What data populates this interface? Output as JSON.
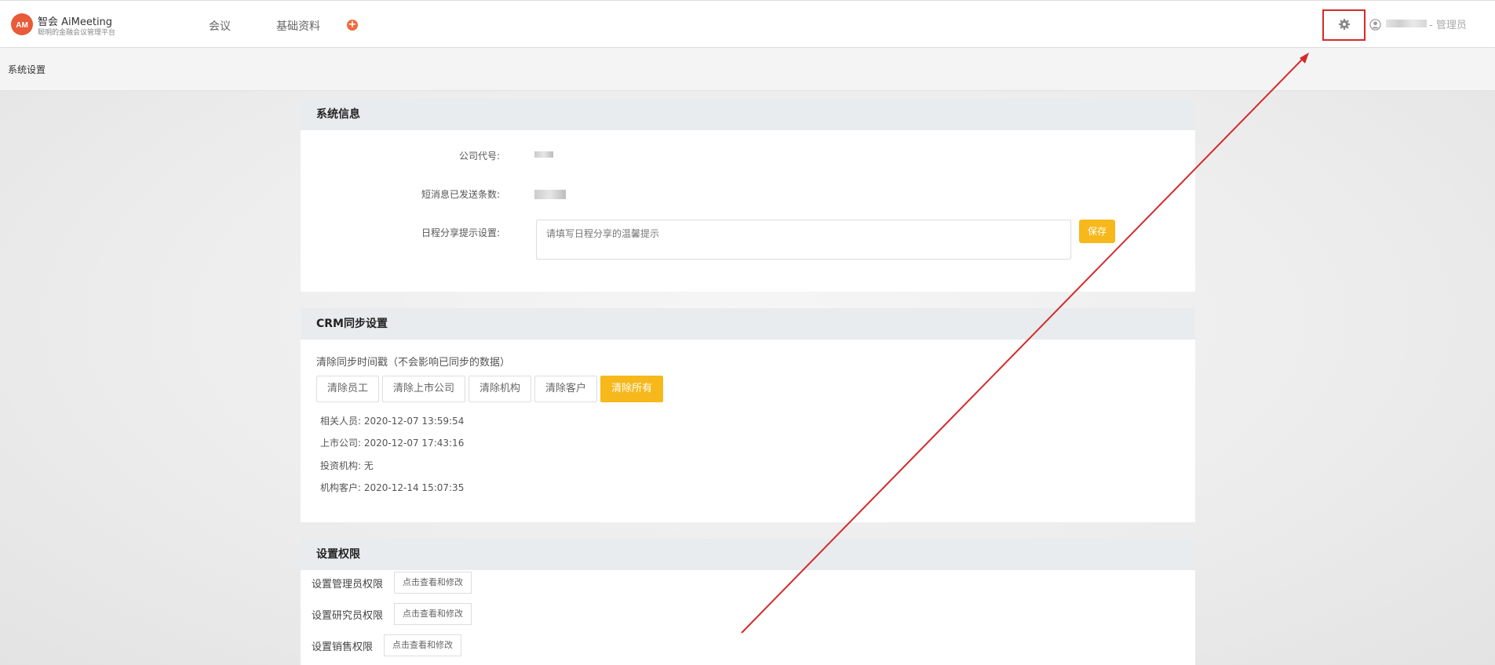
{
  "header": {
    "brand_title": "智会 AiMeeting",
    "brand_subtitle": "聪明的金融会议管理平台",
    "nav": [
      {
        "label": "会议"
      },
      {
        "label": "基础资料"
      }
    ],
    "user_suffix": "- 管理员"
  },
  "breadcrumb": "系统设置",
  "system_info": {
    "title": "系统信息",
    "company_code_label": "公司代号:",
    "sms_sent_label": "短消息已发送条数:",
    "share_tip_label": "日程分享提示设置:",
    "share_tip_placeholder": "请填写日程分享的温馨提示",
    "save_label": "保存"
  },
  "crm": {
    "title": "CRM同步设置",
    "desc": "清除同步时间戳（不会影响已同步的数据）",
    "buttons": [
      "清除员工",
      "清除上市公司",
      "清除机构",
      "清除客户",
      "清除所有"
    ],
    "timestamps": [
      {
        "label": "相关人员:",
        "value": "2020-12-07 13:59:54"
      },
      {
        "label": "上市公司:",
        "value": "2020-12-07 17:43:16"
      },
      {
        "label": "投资机构:",
        "value": "无"
      },
      {
        "label": "机构客户:",
        "value": "2020-12-14 15:07:35"
      }
    ]
  },
  "permissions": {
    "title": "设置权限",
    "rows": [
      {
        "label": "设置管理员权限",
        "button": "点击查看和修改"
      },
      {
        "label": "设置研究员权限",
        "button": "点击查看和修改"
      },
      {
        "label": "设置销售权限",
        "button": "点击查看和修改"
      }
    ]
  },
  "colors": {
    "accent": "#f6b81b",
    "annotation": "#d42a2a",
    "brand": "#e85a3a"
  }
}
